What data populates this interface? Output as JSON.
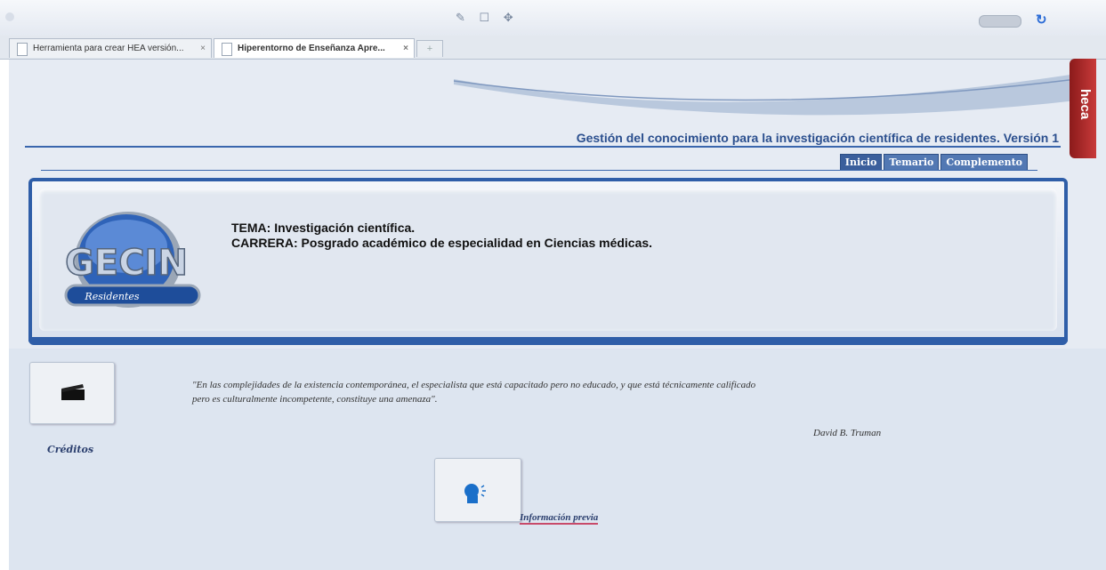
{
  "browser": {
    "tabs": [
      {
        "label": "Herramienta para crear HEA versión..."
      },
      {
        "label": "Hiperentorno de Enseñanza Apre..."
      }
    ],
    "tab_close": "×",
    "new_tab": "+"
  },
  "header": {
    "title": "Gestión del conocimiento para la investigación científica de residentes. Versión 1",
    "nav": [
      "Inicio",
      "Temario",
      "Complemento"
    ]
  },
  "banner": {
    "logo_text": "GECIN",
    "logo_sub": "Residentes",
    "tema": "TEMA: Investigación científica.",
    "carrera": "CARRERA: Posgrado académico de especialidad en Ciencias médicas."
  },
  "content": {
    "creditos_label": "Créditos",
    "quote_line1": "\"En las complejidades de la existencia contemporánea, el especialista que está capacitado pero no educado, y que está técnicamente calificado",
    "quote_line2": "pero es culturalmente incompetente, constituye una amenaza\".",
    "author": "David B. Truman",
    "info_label": "Información previa"
  },
  "side_tab": {
    "label": "heca"
  },
  "colors": {
    "accent": "#2f5ea8",
    "title": "#2b4f8e",
    "nav": "#5278b3",
    "side_tab": "#b02a2a"
  }
}
